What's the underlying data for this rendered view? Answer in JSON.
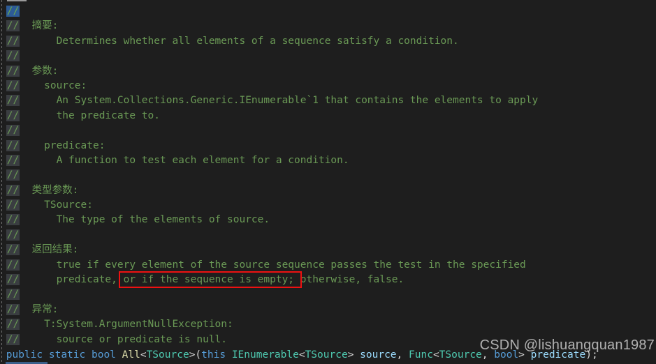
{
  "editor": {
    "language": "csharp",
    "theme": "dark-plus",
    "background_color": "#1e1e1e",
    "comment_color": "#6A9955",
    "selection_color": "#2d5b96",
    "occurrence_highlight_color": "#3a3d41",
    "annotation_color": "#ee1111"
  },
  "comment_token": "//",
  "lines": [
    {
      "indent": "",
      "text": ""
    },
    {
      "indent": " ",
      "text": "摘要:"
    },
    {
      "indent": "     ",
      "text": "Determines whether all elements of a sequence satisfy a condition."
    },
    {
      "indent": "",
      "text": ""
    },
    {
      "indent": " ",
      "text": "参数:"
    },
    {
      "indent": "   ",
      "text": "source:"
    },
    {
      "indent": "     ",
      "text": "An System.Collections.Generic.IEnumerable`1 that contains the elements to apply"
    },
    {
      "indent": "     ",
      "text": "the predicate to."
    },
    {
      "indent": "",
      "text": ""
    },
    {
      "indent": "   ",
      "text": "predicate:"
    },
    {
      "indent": "     ",
      "text": "A function to test each element for a condition."
    },
    {
      "indent": "",
      "text": ""
    },
    {
      "indent": " ",
      "text": "类型参数:"
    },
    {
      "indent": "   ",
      "text": "TSource:"
    },
    {
      "indent": "     ",
      "text": "The type of the elements of source."
    },
    {
      "indent": "",
      "text": ""
    },
    {
      "indent": " ",
      "text": "返回结果:"
    },
    {
      "indent": "     ",
      "text": "true if every element of the source sequence passes the test in the specified"
    },
    {
      "indent": "     ",
      "text": "predicate, or if the sequence is empty; otherwise, false."
    },
    {
      "indent": "",
      "text": ""
    },
    {
      "indent": " ",
      "text": "异常:"
    },
    {
      "indent": "   ",
      "text": "T:System.ArgumentNullException:"
    },
    {
      "indent": "     ",
      "text": "source or predicate is null."
    }
  ],
  "selected_line_index": 0,
  "signature": {
    "tokens": [
      {
        "text": "public",
        "kind": "keyword"
      },
      {
        "text": " ",
        "kind": "plain"
      },
      {
        "text": "static",
        "kind": "keyword"
      },
      {
        "text": " ",
        "kind": "plain"
      },
      {
        "text": "bool",
        "kind": "keyword"
      },
      {
        "text": " ",
        "kind": "plain"
      },
      {
        "text": "All",
        "kind": "method"
      },
      {
        "text": "<",
        "kind": "punct"
      },
      {
        "text": "TSource",
        "kind": "type"
      },
      {
        "text": ">(",
        "kind": "punct"
      },
      {
        "text": "this",
        "kind": "keyword"
      },
      {
        "text": " ",
        "kind": "plain"
      },
      {
        "text": "IEnumerable",
        "kind": "type"
      },
      {
        "text": "<",
        "kind": "punct"
      },
      {
        "text": "TSource",
        "kind": "type"
      },
      {
        "text": "> ",
        "kind": "punct"
      },
      {
        "text": "source",
        "kind": "param"
      },
      {
        "text": ", ",
        "kind": "punct"
      },
      {
        "text": "Func",
        "kind": "type"
      },
      {
        "text": "<",
        "kind": "punct"
      },
      {
        "text": "TSource",
        "kind": "type"
      },
      {
        "text": ", ",
        "kind": "punct"
      },
      {
        "text": "bool",
        "kind": "keyword"
      },
      {
        "text": "> ",
        "kind": "punct"
      },
      {
        "text": "predicate",
        "kind": "param"
      },
      {
        "text": ");",
        "kind": "punct"
      }
    ]
  },
  "annotation": {
    "highlighted_text": "or if the sequence is empty",
    "shape": "rectangle",
    "color": "#ee1111"
  },
  "watermark": {
    "text": "CSDN @lishuangquan1987"
  }
}
